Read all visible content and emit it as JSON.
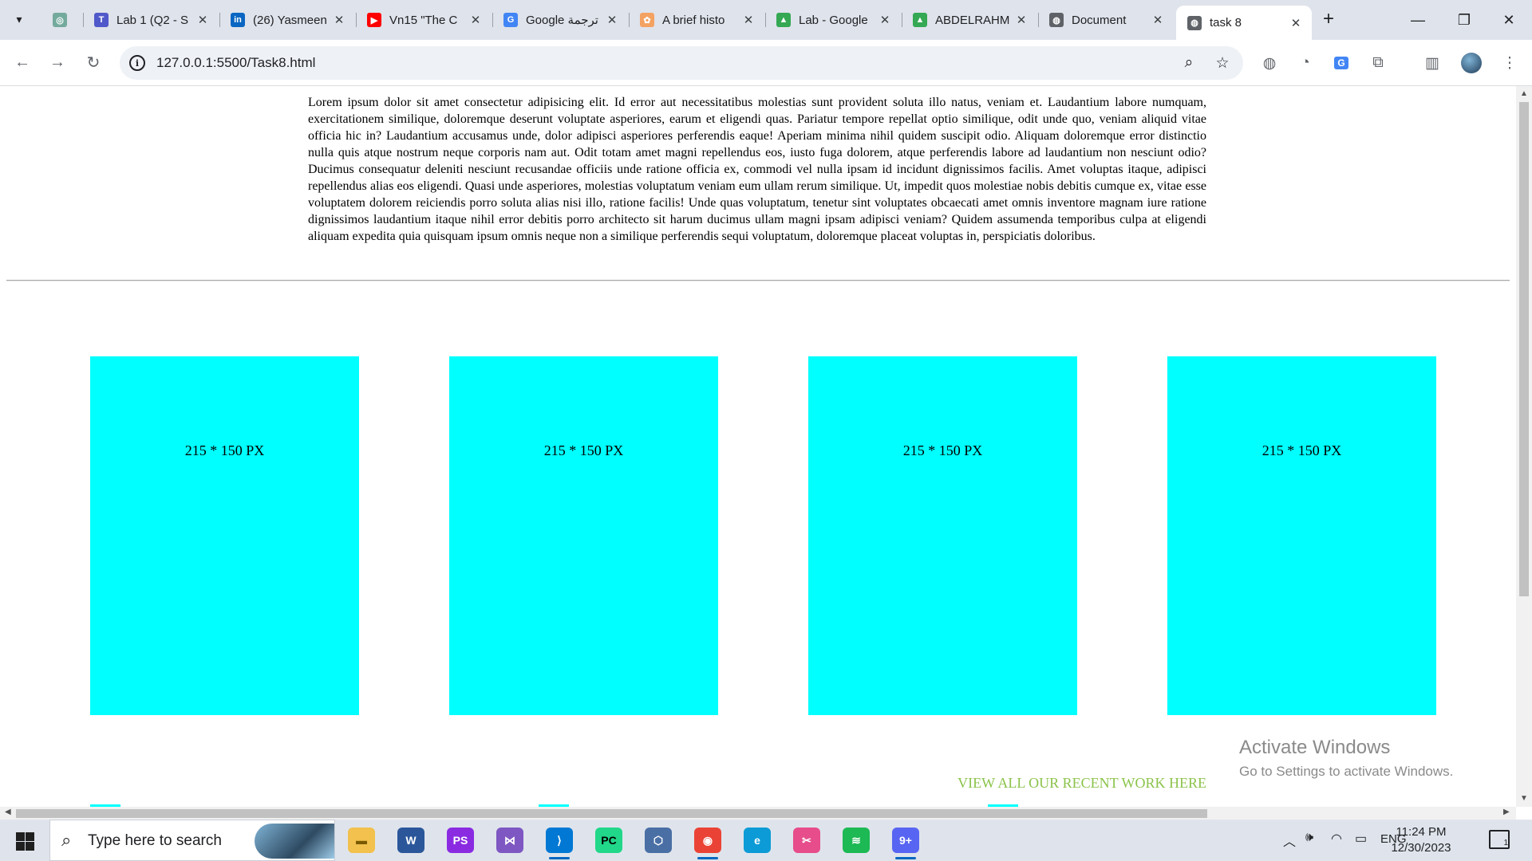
{
  "browser": {
    "tabs": [
      {
        "label": "",
        "icon": "chatgpt-icon",
        "color": "#74aa9c"
      },
      {
        "label": "Lab 1 (Q2 - S",
        "icon": "teams-icon",
        "color": "#5059c9"
      },
      {
        "label": "(26) Yasmeen",
        "icon": "linkedin-icon",
        "color": "#0a66c2"
      },
      {
        "label": "Vn15 \"The C",
        "icon": "youtube-icon",
        "color": "#ff0000"
      },
      {
        "label": "Google ترجمة",
        "icon": "google-translate-icon",
        "color": "#4285f4"
      },
      {
        "label": "A brief histo",
        "icon": "colorful-page-icon",
        "color": "#f4a261"
      },
      {
        "label": "Lab - Google",
        "icon": "google-drive-icon",
        "color": "#34a853"
      },
      {
        "label": "ABDELRAHM",
        "icon": "google-drive-icon",
        "color": "#34a853"
      },
      {
        "label": "Document",
        "icon": "globe-icon",
        "color": "#5f6368"
      },
      {
        "label": "task 8",
        "icon": "globe-icon",
        "color": "#5f6368",
        "active": true
      }
    ],
    "new_tab_symbol": "+",
    "url": "127.0.0.1:5500/Task8.html"
  },
  "page": {
    "paragraph": "Lorem ipsum dolor sit amet consectetur adipisicing elit. Id error aut necessitatibus molestias sunt provident soluta illo natus, veniam et. Laudantium labore numquam, exercitationem similique, doloremque deserunt voluptate asperiores, earum et eligendi quas. Pariatur tempore repellat optio similique, odit unde quo, veniam aliquid vitae officia hic in? Laudantium accusamus unde, dolor adipisci asperiores perferendis eaque! Aperiam minima nihil quidem suscipit odio. Aliquam doloremque error distinctio nulla quis atque nostrum neque corporis nam aut. Odit totam amet magni repellendus eos, iusto fuga dolorem, atque perferendis labore ad laudantium non nesciunt odio? Ducimus consequatur deleniti nesciunt recusandae officiis unde ratione officia ex, commodi vel nulla ipsam id incidunt dignissimos facilis. Amet voluptas itaque, adipisci repellendus alias eos eligendi. Quasi unde asperiores, molestias voluptatum veniam eum ullam rerum similique. Ut, impedit quos molestiae nobis debitis cumque ex, vitae esse voluptatem dolorem reiciendis porro soluta alias nisi illo, ratione facilis! Unde quas voluptatum, tenetur sint voluptates obcaecati amet omnis inventore magnam iure ratione dignissimos laudantium itaque nihil error debitis porro architecto sit harum ducimus ullam magni ipsam adipisci veniam? Quidem assumenda temporibus culpa at eligendi aliquam expedita quia quisquam ipsum omnis neque non a similique perferendis sequi voluptatum, doloremque placeat voluptas in, perspiciatis doloribus.",
    "cards": [
      {
        "label": "215 * 150 PX"
      },
      {
        "label": "215 * 150 PX"
      },
      {
        "label": "215 * 150 PX"
      },
      {
        "label": "215 * 150 PX"
      }
    ],
    "view_all_link": "VIEW ALL OUR RECENT WORK HERE",
    "card_color": "#00ffff",
    "link_color": "#8bc34a"
  },
  "watermark": {
    "title": "Activate Windows",
    "subtitle": "Go to Settings to activate Windows."
  },
  "taskbar": {
    "search_placeholder": "Type here to search",
    "language": "ENG",
    "time": "11:24 PM",
    "date": "12/30/2023",
    "notification_count": "1"
  }
}
